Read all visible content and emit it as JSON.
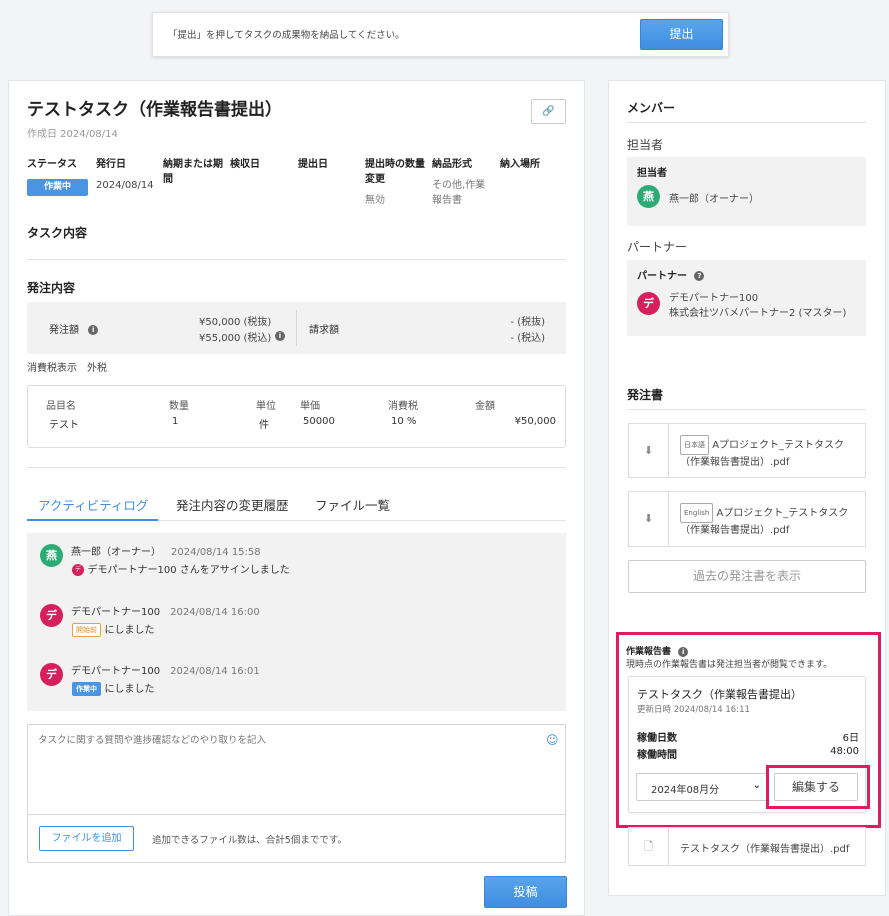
{
  "banner": {
    "text": "「提出」を押してタスクの成果物を納品してください。",
    "submit_label": "提出"
  },
  "task": {
    "title": "テストタスク（作業報告書提出）",
    "created": "作成日 2024/08/14",
    "info": [
      {
        "label": "ステータス",
        "value": ""
      },
      {
        "label": "発行日",
        "value": "2024/08/14"
      },
      {
        "label": "納期または期間",
        "value": ""
      },
      {
        "label": "検収日",
        "value": ""
      },
      {
        "label": "提出日",
        "value": ""
      },
      {
        "label": "提出時の数量変更",
        "value": "無効"
      },
      {
        "label": "納品形式",
        "value": "その他,作業報告書"
      },
      {
        "label": "納入場所",
        "value": ""
      }
    ],
    "status": "作業中",
    "section_content": "タスク内容",
    "section_order": "発注内容",
    "amount_label": "発注額",
    "amount_excl": "¥50,000 (税抜)",
    "amount_incl": "¥55,000 (税込)",
    "invoice_label": "請求額",
    "invoice_excl": "- (税抜)",
    "invoice_incl": "- (税込)",
    "tax_display": "消費税表示　外税",
    "items_headers": [
      "品目名",
      "数量",
      "単位",
      "単価",
      "消費税",
      "金額"
    ],
    "items_row": [
      "テスト",
      "1",
      "件",
      "50000",
      "10 %",
      "¥50,000"
    ]
  },
  "tabs": [
    "アクティビティログ",
    "発注内容の変更履歴",
    "ファイル一覧"
  ],
  "activity": [
    {
      "avatar": "燕",
      "name": "燕一郎（オーナー）",
      "time": "2024/08/14 15:58",
      "mini": "デ",
      "text": "デモパートナー100 さんをアサインしました"
    },
    {
      "avatar": "デ",
      "name": "デモパートナー100",
      "time": "2024/08/14 16:00",
      "tag": "開始前",
      "text": "にしました"
    },
    {
      "avatar": "デ",
      "name": "デモパートナー100",
      "time": "2024/08/14 16:01",
      "tag": "作業中",
      "text": "にしました"
    }
  ],
  "comment": {
    "placeholder": "タスクに関する質問や進捗確認などのやり取りを記入",
    "file_button": "ファイルを追加",
    "file_note": "追加できるファイル数は、合計5個までです。",
    "post_button": "投稿"
  },
  "side": {
    "members_title": "メンバー",
    "assignee_section": "担当者",
    "assignee_label": "担当者",
    "assignee_avatar": "燕",
    "assignee_name": "燕一郎（オーナー）",
    "partner_section": "パートナー",
    "partner_label": "パートナー",
    "partner_avatar": "デ",
    "partner_name": "デモパートナー100",
    "partner_company": "株式会社ツバメパートナー2 (マスター)",
    "orders_title": "発注書",
    "orders": [
      {
        "lang": "日本語",
        "name1": "Aプロジェクト_テストタスク",
        "name2": "（作業報告書提出）.pdf"
      },
      {
        "lang": "English",
        "name1": "Aプロジェクト_テストタスク",
        "name2": "（作業報告書提出）.pdf"
      }
    ],
    "past_orders_button": "過去の発注書を表示",
    "report_title": "作業報告書",
    "report_note": "現時点の作業報告書は発注担当者が閲覧できます。",
    "report_card_title": "テストタスク（作業報告書提出）",
    "report_updated": "更新日時 2024/08/14 16:11",
    "work_days_label": "稼働日数",
    "work_days_value": "6日",
    "work_hours_label": "稼働時間",
    "work_hours_value": "48:00",
    "month_select": "2024年08月分",
    "edit_button": "編集する",
    "report_file": "テストタスク（作業報告書提出）.pdf"
  }
}
